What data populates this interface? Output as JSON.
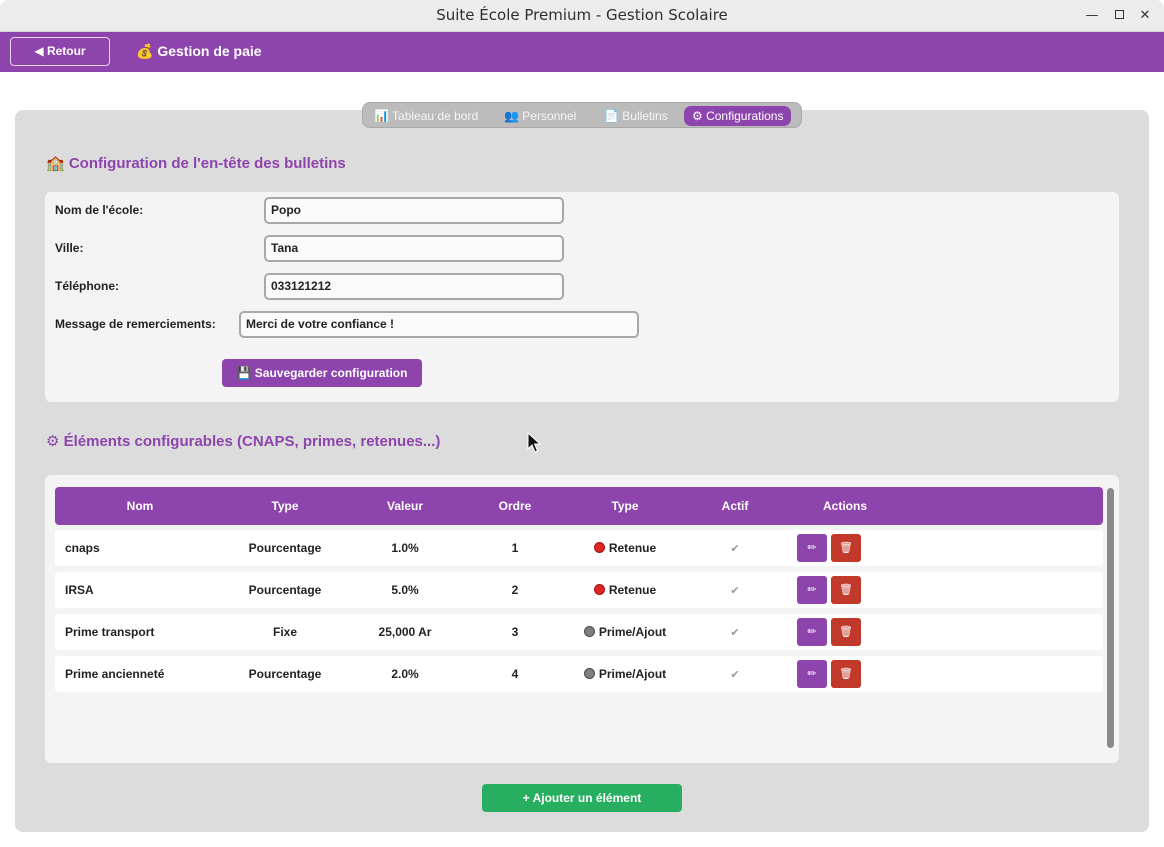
{
  "window": {
    "title": "Suite École Premium - Gestion Scolaire",
    "min_glyph": "—",
    "close_glyph": "✕"
  },
  "header": {
    "back_label": "◀ Retour",
    "title": "💰 Gestion de paie"
  },
  "tabs": [
    {
      "label": "📊 Tableau de bord",
      "active": false
    },
    {
      "label": "👥 Personnel",
      "active": false
    },
    {
      "label": "📄 Bulletins",
      "active": false
    },
    {
      "label": "⚙ Configurations",
      "active": true
    }
  ],
  "config_section": {
    "title": "🏫 Configuration de l'en-tête des bulletins",
    "fields": [
      {
        "label": "Nom de l'école:",
        "value": "Popo"
      },
      {
        "label": "Ville:",
        "value": "Tana"
      },
      {
        "label": "Téléphone:",
        "value": "033121212"
      },
      {
        "label": "Message de remerciements:",
        "value": "Merci de votre confiance !"
      }
    ],
    "save_label": "💾 Sauvegarder configuration"
  },
  "elements_section": {
    "title": "⚙ Éléments configurables (CNAPS, primes, retenues...)",
    "columns": [
      "Nom",
      "Type",
      "Valeur",
      "Ordre",
      "Type",
      "Actif",
      "Actions"
    ],
    "rows": [
      {
        "nom": "cnaps",
        "type": "Pourcentage",
        "valeur": "1.0%",
        "ordre": "1",
        "categorie": "Retenue",
        "categorie_color": "red",
        "actif": "✔"
      },
      {
        "nom": "IRSA",
        "type": "Pourcentage",
        "valeur": "5.0%",
        "ordre": "2",
        "categorie": "Retenue",
        "categorie_color": "red",
        "actif": "✔"
      },
      {
        "nom": "Prime transport",
        "type": "Fixe",
        "valeur": "25,000 Ar",
        "ordre": "3",
        "categorie": "Prime/Ajout",
        "categorie_color": "grey",
        "actif": "✔"
      },
      {
        "nom": "Prime ancienneté",
        "type": "Pourcentage",
        "valeur": "2.0%",
        "ordre": "4",
        "categorie": "Prime/Ajout",
        "categorie_color": "grey",
        "actif": "✔"
      }
    ],
    "edit_glyph": "✏",
    "delete_glyph": "🗑",
    "add_label": "+ Ajouter un élément"
  },
  "colors": {
    "accent": "#8e44ad",
    "danger": "#c0392b",
    "success": "#27ae60"
  }
}
